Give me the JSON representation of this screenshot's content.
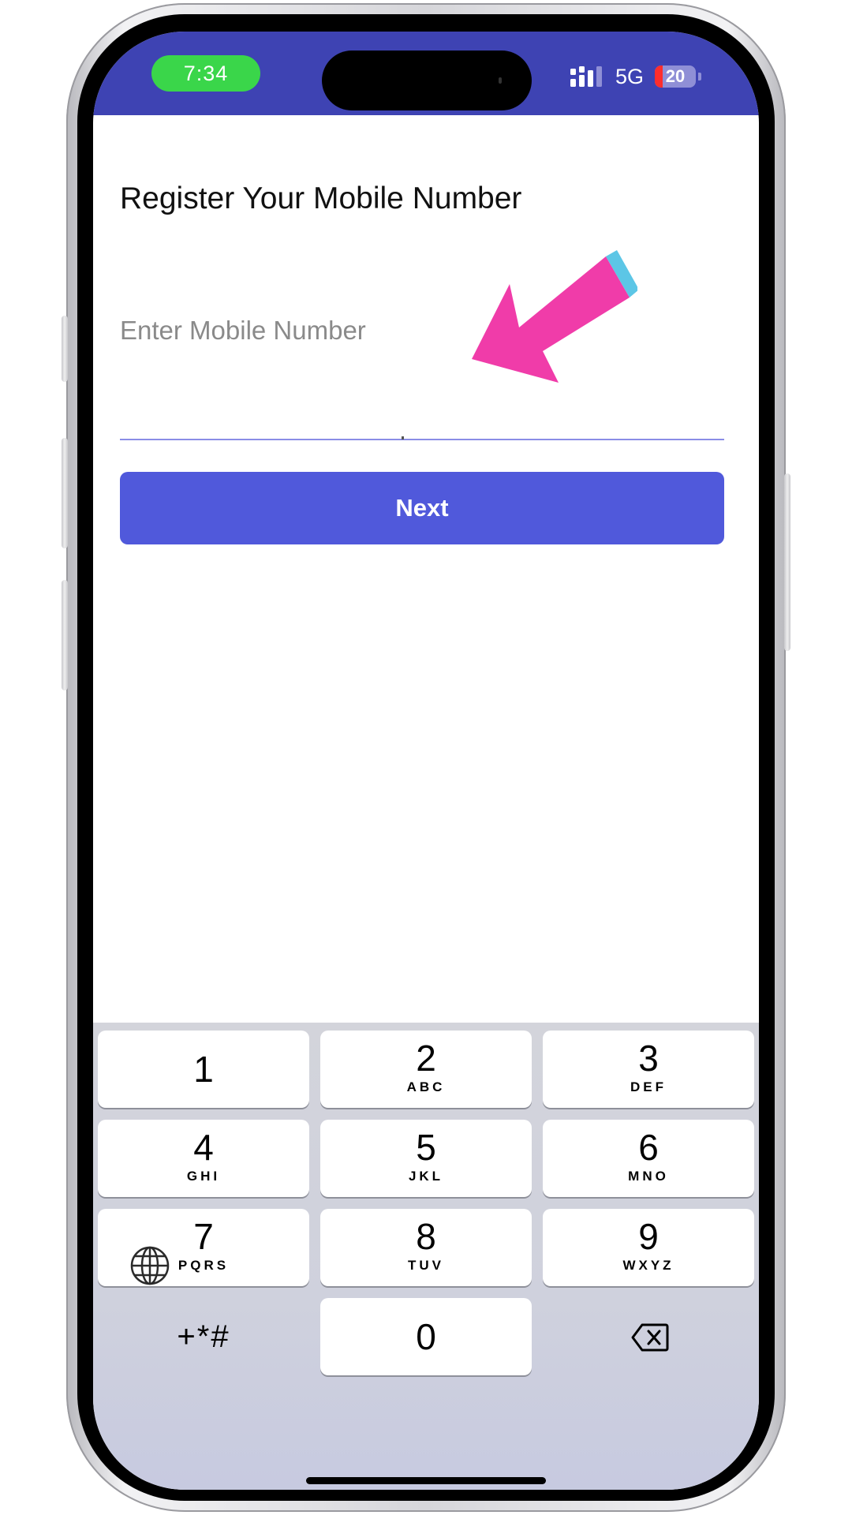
{
  "status_bar": {
    "time": "7:34",
    "network": "5G",
    "battery_level": "20",
    "battery_fraction": 0.2
  },
  "screen": {
    "title": "Register Your Mobile Number",
    "input_placeholder": "Enter Mobile Number",
    "next_label": "Next"
  },
  "colors": {
    "header_bar": "#3e43b3",
    "accent_button": "#5059db",
    "time_pill": "#3ad64a",
    "annotation_arrow": "#f03ca9",
    "annotation_arrow_tip": "#5cc6e6"
  },
  "keyboard": {
    "keys": [
      {
        "digit": "1",
        "letters": ""
      },
      {
        "digit": "2",
        "letters": "ABC"
      },
      {
        "digit": "3",
        "letters": "DEF"
      },
      {
        "digit": "4",
        "letters": "GHI"
      },
      {
        "digit": "5",
        "letters": "JKL"
      },
      {
        "digit": "6",
        "letters": "MNO"
      },
      {
        "digit": "7",
        "letters": "PQRS"
      },
      {
        "digit": "8",
        "letters": "TUV"
      },
      {
        "digit": "9",
        "letters": "WXYZ"
      }
    ],
    "symbols_label": "+*#",
    "zero": "0",
    "delete_icon": "delete-backspace-icon",
    "globe_icon": "globe-icon"
  }
}
